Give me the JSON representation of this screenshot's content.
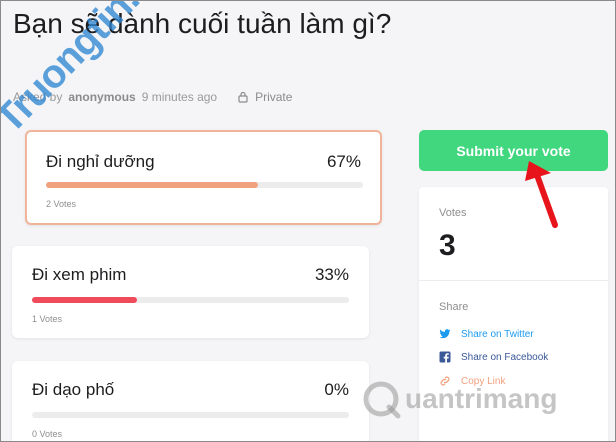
{
  "poll": {
    "title": "Bạn sẽ dành cuối tuần làm gì?",
    "meta": {
      "asked_by": "Asked by",
      "author": "anonymous",
      "time": "9 minutes ago",
      "visibility": "Private"
    }
  },
  "options": [
    {
      "label": "Đi nghỉ dưỡng",
      "percent_text": "67%",
      "percent": 67,
      "votes": "2 Votes",
      "selected": true,
      "color": "#f0a17e"
    },
    {
      "label": "Đi xem phim",
      "percent_text": "33%",
      "percent": 33,
      "votes": "1 Votes",
      "selected": false,
      "color": "#ef4b5b"
    },
    {
      "label": "Đi dạo phố",
      "percent_text": "0%",
      "percent": 0,
      "votes": "0 Votes",
      "selected": false,
      "color": "#ef4b5b"
    }
  ],
  "sidebar": {
    "submit_label": "Submit your vote",
    "votes_label": "Votes",
    "votes_count": "3",
    "share_label": "Share",
    "share": [
      {
        "label": "Share on Twitter",
        "icon": "twitter-icon",
        "color": "#1d9bf0"
      },
      {
        "label": "Share on Facebook",
        "icon": "facebook-icon",
        "color": "#3b5998"
      },
      {
        "label": "Copy Link",
        "icon": "link-icon",
        "color": "#f0a17e"
      }
    ]
  },
  "watermarks": {
    "left": "Truongtin.top",
    "bottom": "uantrimang"
  },
  "colors": {
    "submit": "#40d77f",
    "selected_border": "#f0b49a",
    "arrow": "#e8141b"
  }
}
